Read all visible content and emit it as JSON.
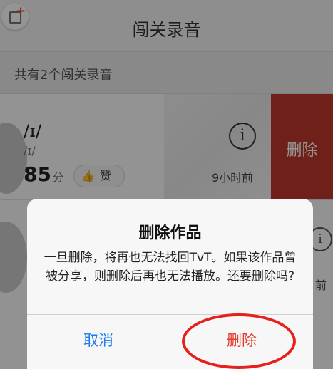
{
  "header": {
    "title": "闯关录音",
    "add_icon": "add-box-icon"
  },
  "summary": {
    "text": "共有2个闯关录音"
  },
  "recording": {
    "phonetic": "/ɪ/",
    "phonetic_sub": "/ɪ/",
    "score": "85",
    "score_unit": "分",
    "like_label": "赞",
    "time": "9小时前",
    "swipe_delete": "删除"
  },
  "recording2": {
    "time_partial": "前"
  },
  "dialog": {
    "title": "删除作品",
    "message": "一旦删除，将再也无法找回TvT。如果该作品曾被分享，则删除后再也无法播放。还要删除吗?",
    "cancel": "取消",
    "confirm": "删除"
  },
  "colors": {
    "accent_red": "#c0392b",
    "cancel_blue": "#1a7ef0",
    "annotation_red": "#e5201d"
  }
}
